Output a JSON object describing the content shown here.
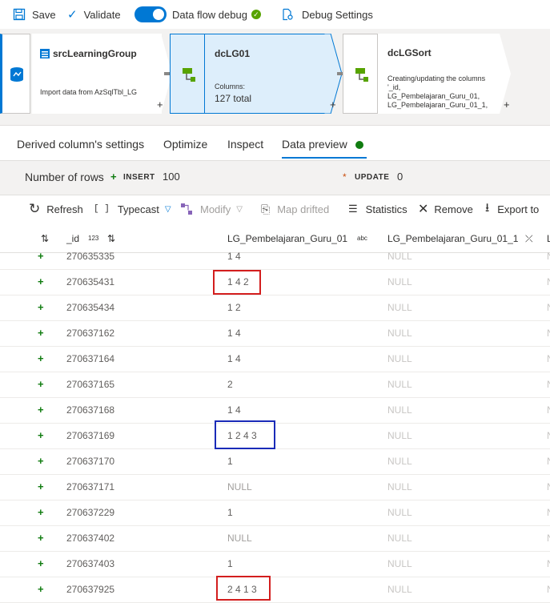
{
  "toolbar": {
    "save_label": "Save",
    "validate_label": "Validate",
    "debug_label": "Data flow debug",
    "debug_settings_label": "Debug Settings"
  },
  "graph": {
    "source": {
      "title": "srcLearningGroup",
      "subtitle": "Import data from AzSqlTbl_LG"
    },
    "derived": {
      "title": "dcLG01",
      "columns_label": "Columns:",
      "columns_value": "127 total"
    },
    "sort": {
      "title": "dcLGSort",
      "desc_lines": [
        "Creating/updating the columns",
        "'_id,",
        "LG_Pembelajaran_Guru_01,",
        "LG_Pembelajaran_Guru_01_1,"
      ]
    },
    "plus": "+"
  },
  "tabs": [
    {
      "label": "Derived column's settings"
    },
    {
      "label": "Optimize"
    },
    {
      "label": "Inspect"
    },
    {
      "label": "Data preview"
    }
  ],
  "summary": {
    "rows_label": "Number of rows",
    "insert_label": "INSERT",
    "insert_value": "100",
    "update_label": "UPDATE",
    "update_value": "0"
  },
  "actions": {
    "refresh": "Refresh",
    "typecast": "Typecast",
    "modify": "Modify",
    "map_drifted": "Map drifted",
    "statistics": "Statistics",
    "remove": "Remove",
    "export": "Export to"
  },
  "table": {
    "columns": [
      "_id",
      "123",
      "LG_Pembelajaran_Guru_01",
      "abc",
      "LG_Pembelajaran_Guru_01_1"
    ],
    "rows": [
      {
        "id": "270635335",
        "v1": "1 4",
        "v2": "NULL",
        "v3": "N"
      },
      {
        "id": "270635431",
        "v1": "1 4 2",
        "v2": "NULL",
        "v3": "N"
      },
      {
        "id": "270635434",
        "v1": "1 2",
        "v2": "NULL",
        "v3": "N"
      },
      {
        "id": "270637162",
        "v1": "1 4",
        "v2": "NULL",
        "v3": "N"
      },
      {
        "id": "270637164",
        "v1": "1 4",
        "v2": "NULL",
        "v3": "N"
      },
      {
        "id": "270637165",
        "v1": "2",
        "v2": "NULL",
        "v3": "N"
      },
      {
        "id": "270637168",
        "v1": "1 4",
        "v2": "NULL",
        "v3": "N"
      },
      {
        "id": "270637169",
        "v1": "1 2 4 3",
        "v2": "NULL",
        "v3": "N"
      },
      {
        "id": "270637170",
        "v1": "1",
        "v2": "NULL",
        "v3": "N"
      },
      {
        "id": "270637171",
        "v1": "NULL",
        "v2": "NULL",
        "v3": "N"
      },
      {
        "id": "270637229",
        "v1": "1",
        "v2": "NULL",
        "v3": "N"
      },
      {
        "id": "270637402",
        "v1": "NULL",
        "v2": "NULL",
        "v3": "N"
      },
      {
        "id": "270637403",
        "v1": "1",
        "v2": "NULL",
        "v3": "N"
      },
      {
        "id": "270637925",
        "v1": "2 4 1 3",
        "v2": "NULL",
        "v3": "N"
      }
    ]
  },
  "colors": {
    "accent": "#0078d4",
    "success": "#107c10",
    "highlight_red": "#d31e1e",
    "highlight_blue": "#1a2bb8"
  }
}
